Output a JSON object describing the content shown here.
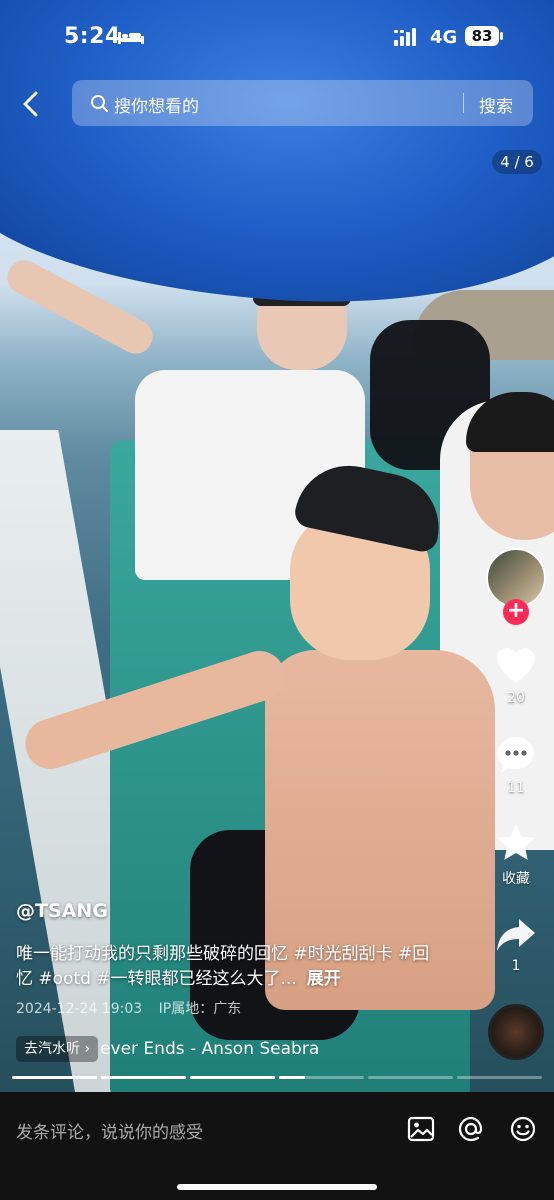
{
  "status_bar": {
    "time": "5:24",
    "network": "4G",
    "battery": "83"
  },
  "search": {
    "placeholder": "搜你想看的",
    "button": "搜索"
  },
  "page_indicator": "4 / 6",
  "actions": {
    "likes": "20",
    "comments": "11",
    "favorite_label": "收藏",
    "shares": "1"
  },
  "post": {
    "author": "@TSANG",
    "caption": "唯一能打动我的只剩那些破碎的回忆 #时光刮刮卡 #回忆 #ootd #一转眼都已经这么大了...",
    "expand": "展开",
    "date": "2024-12-24 19:03",
    "location": "IP属地：广东"
  },
  "music": {
    "chip": "去汽水听",
    "title": "ever Ends - Anson Seabra"
  },
  "progress": {
    "segments": 6,
    "current": 4,
    "current_fill": 0.3
  },
  "bottom": {
    "comment_placeholder": "发条评论，说说你的感受"
  },
  "colors": {
    "follow": "#fe2c55",
    "bottom_bar": "#121212"
  },
  "icons": [
    "back-icon",
    "search-icon",
    "heart-icon",
    "comment-icon",
    "star-icon",
    "share-icon",
    "image-icon",
    "at-icon",
    "emoji-icon"
  ]
}
